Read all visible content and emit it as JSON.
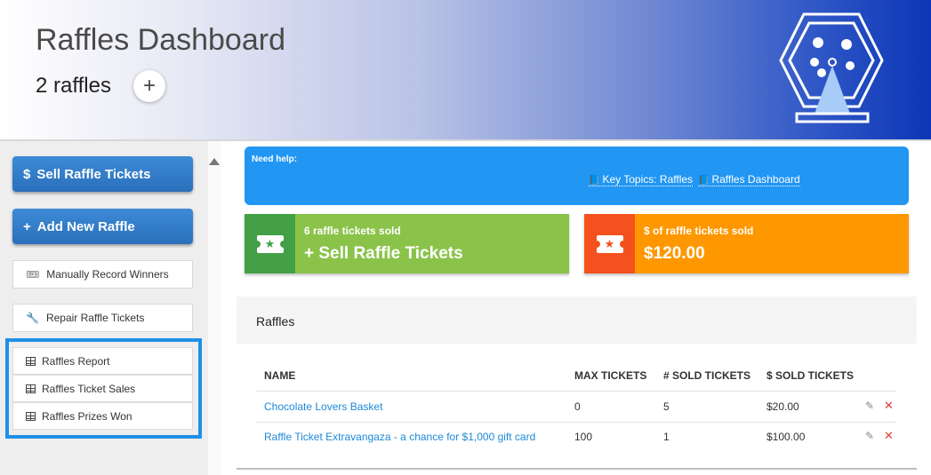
{
  "header": {
    "title": "Raffles Dashboard",
    "count": "2 raffles",
    "add_label": "+"
  },
  "sidebar": {
    "sell_button": "Sell Raffle Tickets",
    "sell_icon": "$",
    "add_button": "Add New Raffle",
    "add_icon": "+",
    "manual_winners": "Manually Record Winners",
    "repair_tickets": "Repair Raffle Tickets",
    "reports": [
      {
        "label": "Raffles Report"
      },
      {
        "label": "Raffles Ticket Sales"
      },
      {
        "label": "Raffles Prizes Won"
      }
    ]
  },
  "help": {
    "title": "Need help:",
    "links": [
      {
        "label": "Key Topics: Raffles"
      },
      {
        "label": "Raffles Dashboard"
      }
    ]
  },
  "stats": {
    "sold": {
      "small": "6 raffle tickets sold",
      "big": "+ Sell Raffle Tickets",
      "color": "#8bc34a",
      "icon_color": "#43a047"
    },
    "amount": {
      "small": "$ of raffle tickets sold",
      "big": "$120.00",
      "color": "#ff9800",
      "icon_color": "#f4511e"
    }
  },
  "raffles": {
    "title": "Raffles",
    "columns": [
      "NAME",
      "MAX TICKETS",
      "# SOLD TICKETS",
      "$ SOLD TICKETS"
    ],
    "rows": [
      {
        "name": "Chocolate Lovers Basket",
        "max": "0",
        "sold": "5",
        "amount": "$20.00"
      },
      {
        "name": "Raffle Ticket Extravangaza - a chance for $1,000 gift card",
        "max": "100",
        "sold": "1",
        "amount": "$100.00"
      }
    ],
    "edit_icon": "✎",
    "delete_icon": "✕"
  }
}
